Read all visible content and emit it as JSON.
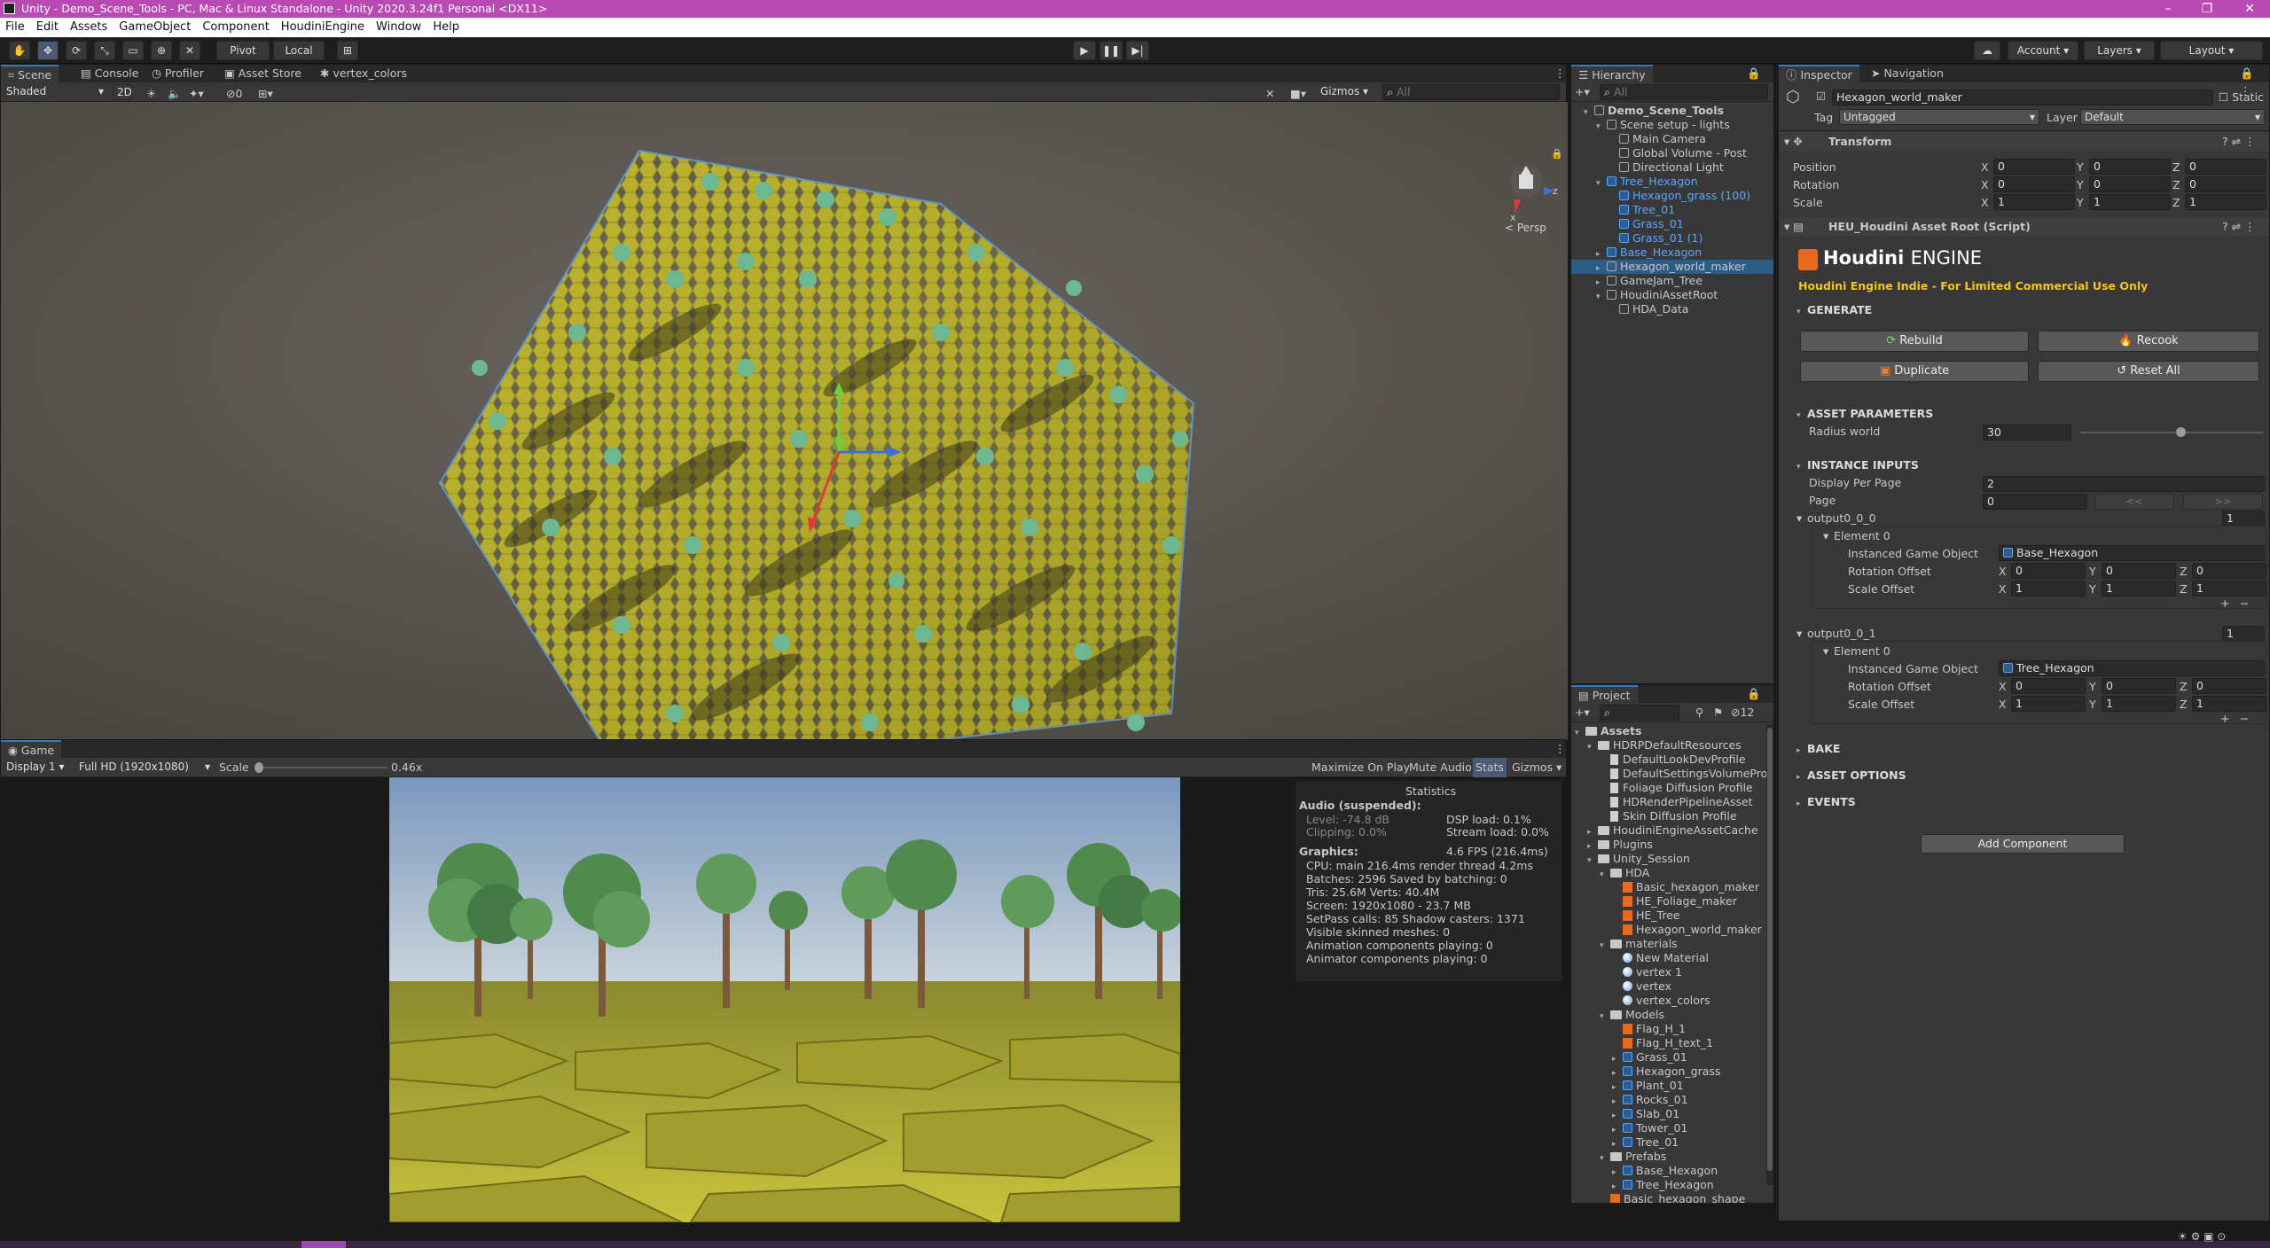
{
  "window": {
    "title": "Unity - Demo_Scene_Tools - PC, Mac & Linux Standalone - Unity 2020.3.24f1 Personal <DX11>"
  },
  "menu": [
    "File",
    "Edit",
    "Assets",
    "GameObject",
    "Component",
    "HoudiniEngine",
    "Window",
    "Help"
  ],
  "toolbar": {
    "pivot": "Pivot",
    "local": "Local",
    "account": "Account",
    "layers": "Layers",
    "layout": "Layout"
  },
  "scene": {
    "tabs": [
      "Scene",
      "Console",
      "Profiler",
      "Asset Store",
      "vertex_colors"
    ],
    "shading": "Shaded",
    "mode2d": "2D",
    "hidden_count": "0",
    "gizmos": "Gizmos",
    "search_placeholder": "All",
    "persp": "< Persp",
    "axis_x": "x",
    "axis_z": "z"
  },
  "game": {
    "tab": "Game",
    "display": "Display 1",
    "resolution": "Full HD (1920x1080)",
    "scale_label": "Scale",
    "scale_value": "0.46x",
    "buttons": [
      "Maximize On Play",
      "Mute Audio",
      "Stats",
      "Gizmos"
    ],
    "stats": {
      "title": "Statistics",
      "audio": "Audio (suspended):",
      "level": "Level: -74.8 dB",
      "clipping": "Clipping: 0.0%",
      "dsp": "DSP load: 0.1%",
      "stream": "Stream load: 0.0%",
      "graphics": "Graphics:",
      "fps": "4.6 FPS (216.4ms)",
      "lines": [
        "CPU: main 216.4ms  render thread 4.2ms",
        "Batches: 2596   Saved by batching: 0",
        "Tris: 25.6M       Verts: 40.4M",
        "Screen: 1920x1080 - 23.7 MB",
        "SetPass calls: 85         Shadow casters: 1371",
        "Visible skinned meshes: 0",
        "Animation components playing: 0",
        "Animator components playing: 0"
      ]
    }
  },
  "hierarchy": {
    "tab": "Hierarchy",
    "search_placeholder": "All",
    "items": [
      {
        "label": "Demo_Scene_Tools",
        "indent": 0,
        "kind": "scene"
      },
      {
        "label": "Scene setup - lights",
        "indent": 1,
        "kind": "go"
      },
      {
        "label": "Main Camera",
        "indent": 2,
        "kind": "go"
      },
      {
        "label": "Global Volume - Post",
        "indent": 2,
        "kind": "go"
      },
      {
        "label": "Directional Light",
        "indent": 2,
        "kind": "go"
      },
      {
        "label": "Tree_Hexagon",
        "indent": 1,
        "kind": "prefab"
      },
      {
        "label": "Hexagon_grass (100)",
        "indent": 2,
        "kind": "prefab"
      },
      {
        "label": "Tree_01",
        "indent": 2,
        "kind": "prefab"
      },
      {
        "label": "Grass_01",
        "indent": 2,
        "kind": "prefab"
      },
      {
        "label": "Grass_01 (1)",
        "indent": 2,
        "kind": "prefab"
      },
      {
        "label": "Base_Hexagon",
        "indent": 1,
        "kind": "prefab"
      },
      {
        "label": "Hexagon_world_maker",
        "indent": 1,
        "kind": "go"
      },
      {
        "label": "GameJam_Tree",
        "indent": 1,
        "kind": "go"
      },
      {
        "label": "HoudiniAssetRoot",
        "indent": 1,
        "kind": "go"
      },
      {
        "label": "HDA_Data",
        "indent": 2,
        "kind": "go"
      }
    ]
  },
  "project": {
    "tab": "Project",
    "count": "12",
    "items": [
      {
        "label": "Assets",
        "indent": 0,
        "kind": "folder"
      },
      {
        "label": "HDRPDefaultResources",
        "indent": 1,
        "kind": "folder"
      },
      {
        "label": "DefaultLookDevProfile",
        "indent": 2,
        "kind": "file"
      },
      {
        "label": "DefaultSettingsVolumeProfi",
        "indent": 2,
        "kind": "file"
      },
      {
        "label": "Foliage Diffusion Profile",
        "indent": 2,
        "kind": "file"
      },
      {
        "label": "HDRenderPipelineAsset",
        "indent": 2,
        "kind": "file"
      },
      {
        "label": "Skin Diffusion Profile",
        "indent": 2,
        "kind": "file"
      },
      {
        "label": "HoudiniEngineAssetCache",
        "indent": 1,
        "kind": "folder"
      },
      {
        "label": "Plugins",
        "indent": 1,
        "kind": "folder"
      },
      {
        "label": "Unity_Session",
        "indent": 1,
        "kind": "folder"
      },
      {
        "label": "HDA",
        "indent": 2,
        "kind": "folder"
      },
      {
        "label": "Basic_hexagon_maker",
        "indent": 3,
        "kind": "hda"
      },
      {
        "label": "HE_Foliage_maker",
        "indent": 3,
        "kind": "hda"
      },
      {
        "label": "HE_Tree",
        "indent": 3,
        "kind": "hda"
      },
      {
        "label": "Hexagon_world_maker",
        "indent": 3,
        "kind": "hda"
      },
      {
        "label": "materials",
        "indent": 2,
        "kind": "folder"
      },
      {
        "label": "New Material",
        "indent": 3,
        "kind": "mat"
      },
      {
        "label": "vertex 1",
        "indent": 3,
        "kind": "mat"
      },
      {
        "label": "vertex",
        "indent": 3,
        "kind": "mat"
      },
      {
        "label": "vertex_colors",
        "indent": 3,
        "kind": "mat"
      },
      {
        "label": "Models",
        "indent": 2,
        "kind": "folder"
      },
      {
        "label": "Flag_H_1",
        "indent": 3,
        "kind": "hda"
      },
      {
        "label": "Flag_H_text_1",
        "indent": 3,
        "kind": "hda"
      },
      {
        "label": "Grass_01",
        "indent": 3,
        "kind": "model"
      },
      {
        "label": "Hexagon_grass",
        "indent": 3,
        "kind": "model"
      },
      {
        "label": "Plant_01",
        "indent": 3,
        "kind": "model"
      },
      {
        "label": "Rocks_01",
        "indent": 3,
        "kind": "model"
      },
      {
        "label": "Slab_01",
        "indent": 3,
        "kind": "model"
      },
      {
        "label": "Tower_01",
        "indent": 3,
        "kind": "model"
      },
      {
        "label": "Tree_01",
        "indent": 3,
        "kind": "model"
      },
      {
        "label": "Prefabs",
        "indent": 2,
        "kind": "folder"
      },
      {
        "label": "Base_Hexagon",
        "indent": 3,
        "kind": "model"
      },
      {
        "label": "Tree_Hexagon",
        "indent": 3,
        "kind": "model"
      },
      {
        "label": "Basic_hexagon_shape",
        "indent": 2,
        "kind": "hda"
      }
    ]
  },
  "inspector": {
    "tabs": [
      "Inspector",
      "Navigation"
    ],
    "object_name": "Hexagon_world_maker",
    "static": "Static",
    "tag_label": "Tag",
    "tag": "Untagged",
    "layer_label": "Layer",
    "layer": "Default",
    "transform": {
      "title": "Transform",
      "rows": [
        {
          "label": "Position",
          "x": "0",
          "y": "0",
          "z": "0"
        },
        {
          "label": "Rotation",
          "x": "0",
          "y": "0",
          "z": "0"
        },
        {
          "label": "Scale",
          "x": "1",
          "y": "1",
          "z": "1"
        }
      ]
    },
    "script": {
      "title": "HEU_Houdini Asset Root (Script)"
    },
    "houdini": {
      "brand": "Houdini",
      "brand2": "ENGINE",
      "license": "Houdini Engine Indie - For Limited Commercial Use Only"
    },
    "generate": {
      "title": "GENERATE",
      "rebuild": "Rebuild",
      "recook": "Recook",
      "duplicate": "Duplicate",
      "reset": "Reset All"
    },
    "asset_params": {
      "title": "ASSET PARAMETERS",
      "radius_label": "Radius world",
      "radius": "30",
      "slider_fraction": 0.55
    },
    "instance_inputs": {
      "title": "INSTANCE INPUTS",
      "display_label": "Display Per Page",
      "display": "2",
      "page_label": "Page",
      "page": "0",
      "prev": "<<",
      "next": ">>"
    },
    "outputs": [
      {
        "name": "output0_0_0",
        "count": "1",
        "element": "Element 0",
        "go_label": "Instanced Game Object",
        "go": "Base_Hexagon",
        "rot_label": "Rotation Offset",
        "rot": {
          "x": "0",
          "y": "0",
          "z": "0"
        },
        "scale_label": "Scale Offset",
        "scale": {
          "x": "1",
          "y": "1",
          "z": "1"
        }
      },
      {
        "name": "output0_0_1",
        "count": "1",
        "element": "Element 0",
        "go_label": "Instanced Game Object",
        "go": "Tree_Hexagon",
        "rot_label": "Rotation Offset",
        "rot": {
          "x": "0",
          "y": "0",
          "z": "0"
        },
        "scale_label": "Scale Offset",
        "scale": {
          "x": "1",
          "y": "1",
          "z": "1"
        }
      }
    ],
    "bake": "BAKE",
    "asset_options": "ASSET OPTIONS",
    "events": "EVENTS",
    "add_component": "Add Component"
  },
  "colors": {
    "accent": "#3a79bb",
    "titlebar": "#b94ab4",
    "prefab": "#5aa7ff",
    "license": "#f5c518",
    "houdini": "#e66a1f"
  }
}
